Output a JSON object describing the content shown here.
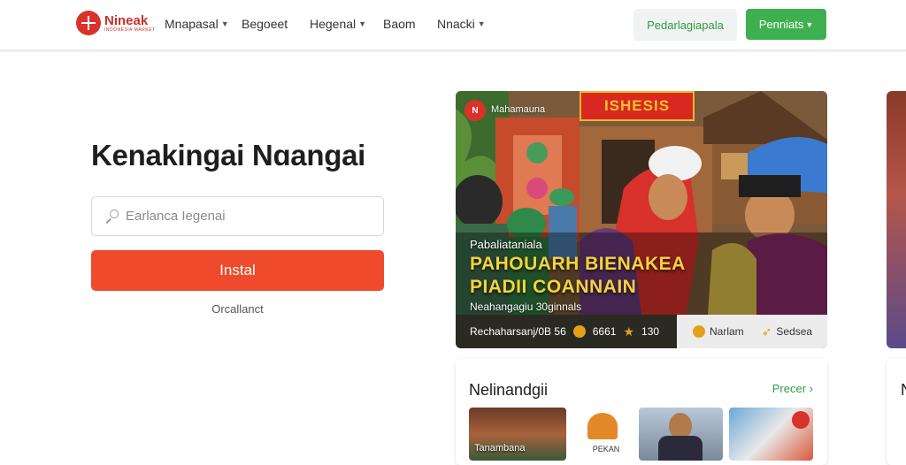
{
  "header": {
    "logo_name": "Nineak",
    "logo_sub": "INDONESIA MARKET",
    "nav": [
      {
        "label": "Mnapasal",
        "dropdown": true
      },
      {
        "label": "Begoeet",
        "dropdown": false
      },
      {
        "label": "Hegenal",
        "dropdown": true
      },
      {
        "label": "Baom",
        "dropdown": false
      },
      {
        "label": "Nnacki",
        "dropdown": true
      }
    ],
    "secondary_button": "Pedarlagiapala",
    "primary_button": "Penniats"
  },
  "hero": {
    "title": "Kenakingai Nɑangai",
    "search_placeholder": "Earlanca Iegenai",
    "install_button": "Instal",
    "sub_link": "Orcallanct"
  },
  "featured": {
    "badge": "N",
    "brand": "Mahamauna",
    "sign": "ISHESIS",
    "kicker": "Pabaliataniala",
    "headline_line1": "PAHOUARH BIENAKEA",
    "headline_line2": "PIADII COANNAIN",
    "meta": "Neahangagiu 30ginnals",
    "footer_left_text": "Rechaharsanj/0B 56",
    "footer_count": "6661",
    "footer_rating": "130",
    "footer_action1": "Narlam",
    "footer_action2": "Sedsea"
  },
  "section": {
    "title": "Nelinandgii",
    "more_link": "Precer",
    "thumb1_caption": "Tanambana",
    "thumb2_caption": "PEKAN"
  },
  "peek": {
    "section_letter": "N"
  },
  "colors": {
    "brand_red": "#d8322b",
    "install_orange": "#ef4a2c",
    "green": "#3fb04f",
    "headline_yellow": "#f6d33b"
  }
}
